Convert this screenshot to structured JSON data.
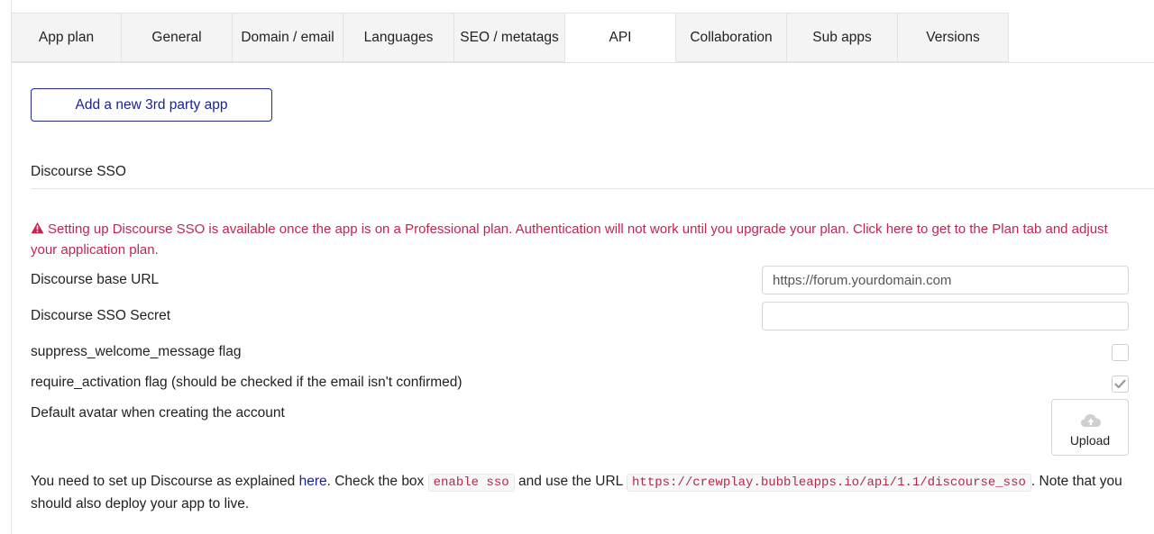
{
  "tabs": [
    "App plan",
    "General",
    "Domain / email",
    "Languages",
    "SEO / metatags",
    "API",
    "Collaboration",
    "Sub apps",
    "Versions"
  ],
  "active_tab": "API",
  "add_button_label": "Add a new 3rd party app",
  "section_title": "Discourse SSO",
  "warning_text": "Setting up Discourse SSO is available once the app is on a Professional plan. Authentication will not work until you upgrade your plan. Click here to get to the Plan tab and adjust your application plan.",
  "fields": {
    "base_url_label": "Discourse base URL",
    "base_url_placeholder": "https://forum.yourdomain.com",
    "base_url_value": "",
    "secret_label": "Discourse SSO Secret",
    "secret_value": "",
    "suppress_label": "suppress_welcome_message flag",
    "suppress_checked": false,
    "require_label": "require_activation flag (should be checked if the email isn't confirmed)",
    "require_checked": true,
    "avatar_label": "Default avatar when creating the account",
    "upload_label": "Upload"
  },
  "note": {
    "part1": "You need to set up Discourse as explained ",
    "link": "here",
    "part2": ". Check the box ",
    "code1": "enable sso",
    "part3": " and use the URL ",
    "code2": "https://crewplay.bubbleapps.io/api/1.1/discourse_sso",
    "part4": ". Note that you should also deploy your app to live."
  },
  "colors": {
    "warning": "#c8234f",
    "link": "#1a2299",
    "code_text": "#b02a4b"
  },
  "icons": {
    "warning": "warning-triangle-icon",
    "checkmark": "checkmark-icon",
    "upload": "cloud-upload-icon"
  }
}
